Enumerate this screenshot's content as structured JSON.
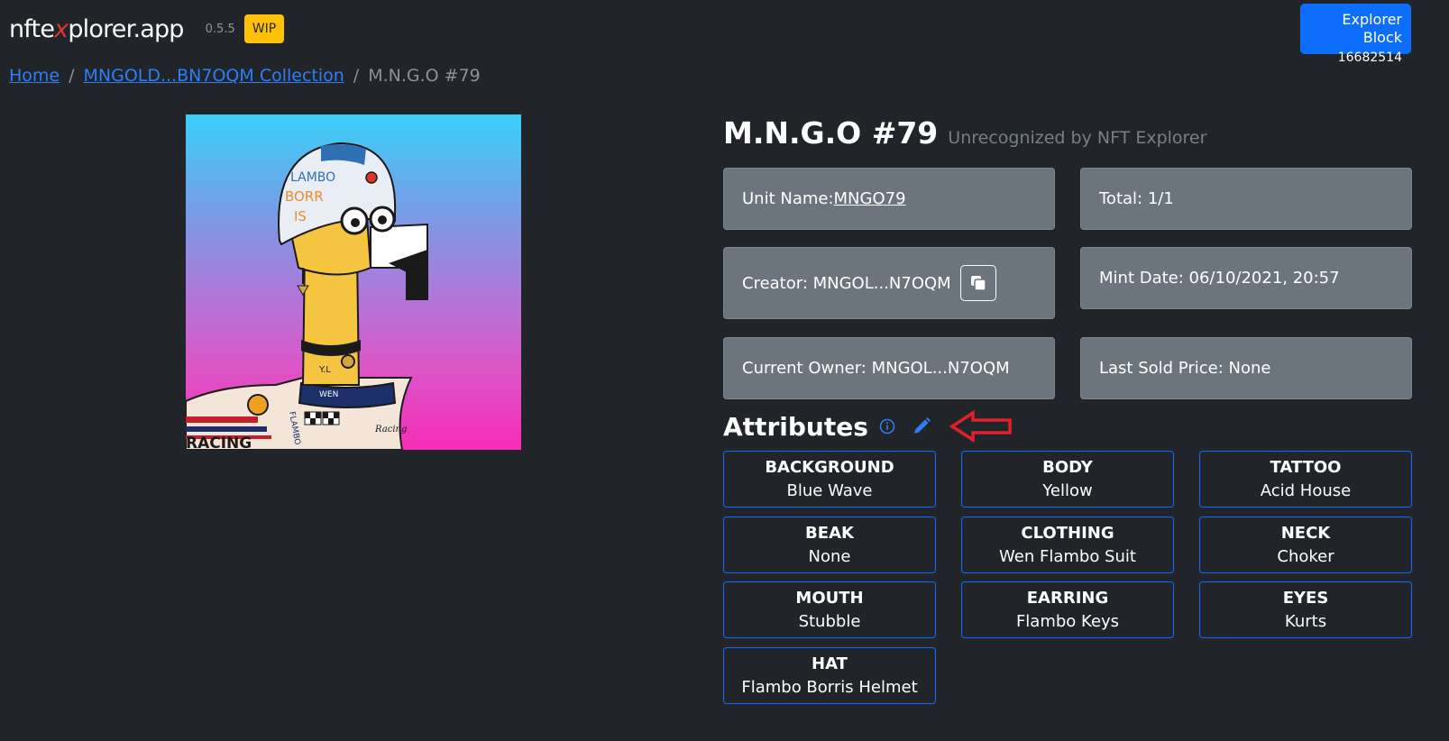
{
  "header": {
    "brand_prefix": "nfte",
    "brand_x": "x",
    "brand_suffix": "plorer.app",
    "version": "0.5.5",
    "wip_badge": "WIP",
    "explorer_block_label": "Explorer Block",
    "explorer_block_number": "16682514"
  },
  "breadcrumb": {
    "home": "Home",
    "separator": "/",
    "collection": "MNGOLD...BN7OQM Collection",
    "current": "M.N.G.O #79"
  },
  "asset": {
    "title": "M.N.G.O #79",
    "subtitle": "Unrecognized by NFT Explorer",
    "unit_name_label": "Unit Name: ",
    "unit_name_value": "MNGO79",
    "total": "Total: 1/1",
    "creator": "Creator: MNGOL...N7OQM",
    "mint_date": "Mint Date: 06/10/2021, 20:57",
    "current_owner": "Current Owner: MNGOL...N7OQM",
    "last_sold_price": "Last Sold Price: None"
  },
  "image_text": {
    "helmet_line1": "LAMBO",
    "helmet_line2": "BORR",
    "helmet_line3": "IS",
    "neck_text": "Y.L",
    "collar_text": "WEN",
    "sleeve_text": "FLAMBO",
    "suit_text": "Racing",
    "bottom_text": "RACING"
  },
  "attributes": {
    "heading": "Attributes",
    "items": [
      {
        "key": "BACKGROUND",
        "value": "Blue Wave"
      },
      {
        "key": "BODY",
        "value": "Yellow"
      },
      {
        "key": "TATTOO",
        "value": "Acid House"
      },
      {
        "key": "BEAK",
        "value": "None"
      },
      {
        "key": "CLOTHING",
        "value": "Wen Flambo Suit"
      },
      {
        "key": "NECK",
        "value": "Choker"
      },
      {
        "key": "MOUTH",
        "value": "Stubble"
      },
      {
        "key": "EARRING",
        "value": "Flambo Keys"
      },
      {
        "key": "EYES",
        "value": "Kurts"
      },
      {
        "key": "HAT",
        "value": "Flambo Borris Helmet"
      }
    ]
  },
  "colors": {
    "background": "#212529",
    "primary": "#0d6efd",
    "card": "#6c757d",
    "warning": "#ffc107",
    "annotation_arrow": "#e0202a"
  },
  "icons": [
    "copy-icon",
    "info-icon",
    "pencil-icon",
    "arrow-left-icon"
  ]
}
